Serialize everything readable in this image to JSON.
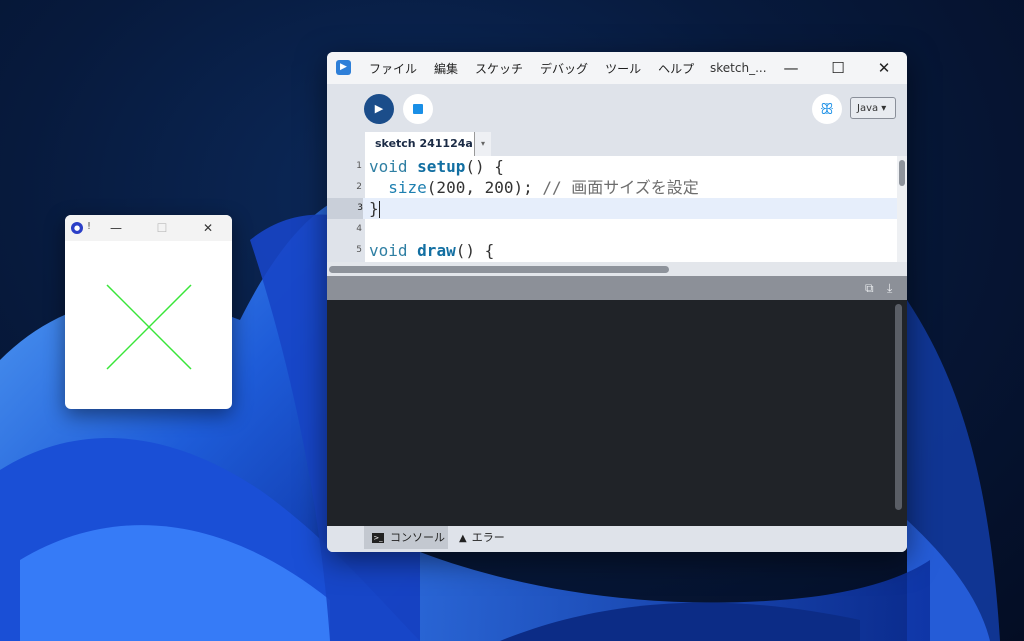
{
  "sketch_window": {
    "title_dot": "!",
    "minimize_icon": "minimize-icon",
    "maximize_icon": "maximize-icon",
    "close_icon": "close-icon",
    "line_color": "#39e639"
  },
  "ide": {
    "menu": [
      "ファイル",
      "編集",
      "スケッチ",
      "デバッグ",
      "ツール",
      "ヘルプ"
    ],
    "window_title": "sketch_...",
    "mode": "Java ▾",
    "tab": {
      "label": "sketch 241124a",
      "menu": "▾"
    },
    "code_lines": [
      {
        "number": "1",
        "parts": [
          [
            "kw",
            "void "
          ],
          [
            "fn",
            "setup"
          ],
          [
            "",
            "() {"
          ]
        ]
      },
      {
        "number": "2",
        "parts": [
          [
            "",
            "  "
          ],
          [
            "bfn",
            "size"
          ],
          [
            "",
            "(200, 200); "
          ],
          [
            "cm",
            "// 画面サイズを設定"
          ]
        ]
      },
      {
        "number": "3",
        "parts": [
          [
            "",
            "}"
          ]
        ]
      },
      {
        "number": "4",
        "parts": []
      },
      {
        "number": "5",
        "parts": [
          [
            "kw",
            "void "
          ],
          [
            "fn",
            "draw"
          ],
          [
            "",
            "() {"
          ]
        ]
      }
    ],
    "console_tab": "コンソール",
    "error_tab": "エラー"
  },
  "colors": {
    "run_button": "#1b4d8a",
    "stop_square": "#1a8fe6",
    "console_bg": "#202328"
  }
}
